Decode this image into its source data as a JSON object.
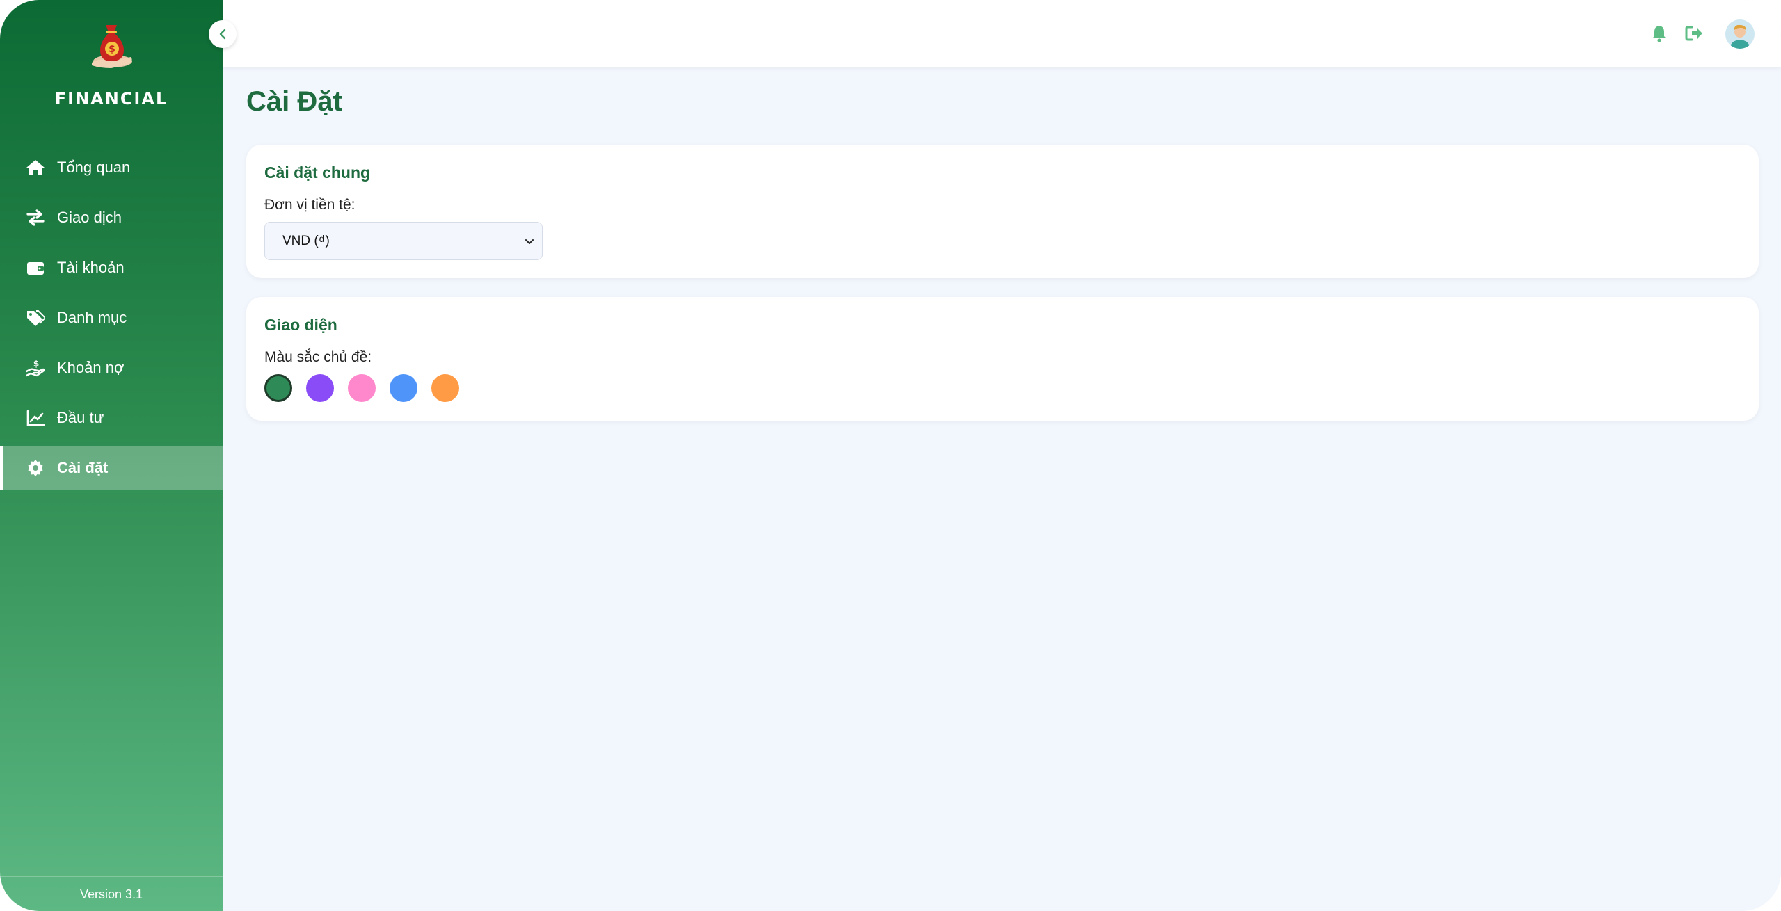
{
  "sidebar": {
    "brand": "FINANCIAL",
    "items": [
      {
        "label": "Tổng quan",
        "icon": "home-icon"
      },
      {
        "label": "Giao dịch",
        "icon": "transfer-arrows-icon"
      },
      {
        "label": "Tài khoản",
        "icon": "wallet-icon"
      },
      {
        "label": "Danh mục",
        "icon": "tags-icon"
      },
      {
        "label": "Khoản nợ",
        "icon": "hand-holding-dollar-icon"
      },
      {
        "label": "Đầu tư",
        "icon": "line-chart-icon"
      },
      {
        "label": "Cài đặt",
        "icon": "gear-icon",
        "active": true
      }
    ],
    "version": "Version 3.1"
  },
  "header": {
    "icons": [
      "bell-icon",
      "logout-icon",
      "avatar"
    ]
  },
  "page": {
    "title": "Cài Đặt"
  },
  "general": {
    "title": "Cài đặt chung",
    "currency_label": "Đơn vị tiền tệ:",
    "currency_value": "VND (₫)"
  },
  "appearance": {
    "title": "Giao diện",
    "theme_label": "Màu sắc chủ đề:",
    "theme_colors": [
      "#2e8b57",
      "#8a4cf7",
      "#ff88cc",
      "#4f94f9",
      "#ff9b45"
    ],
    "selected_index": 0
  },
  "colors": {
    "primary": "#1e6b3f",
    "accent_icon": "#5dbd84",
    "background": "#f2f6fd"
  }
}
